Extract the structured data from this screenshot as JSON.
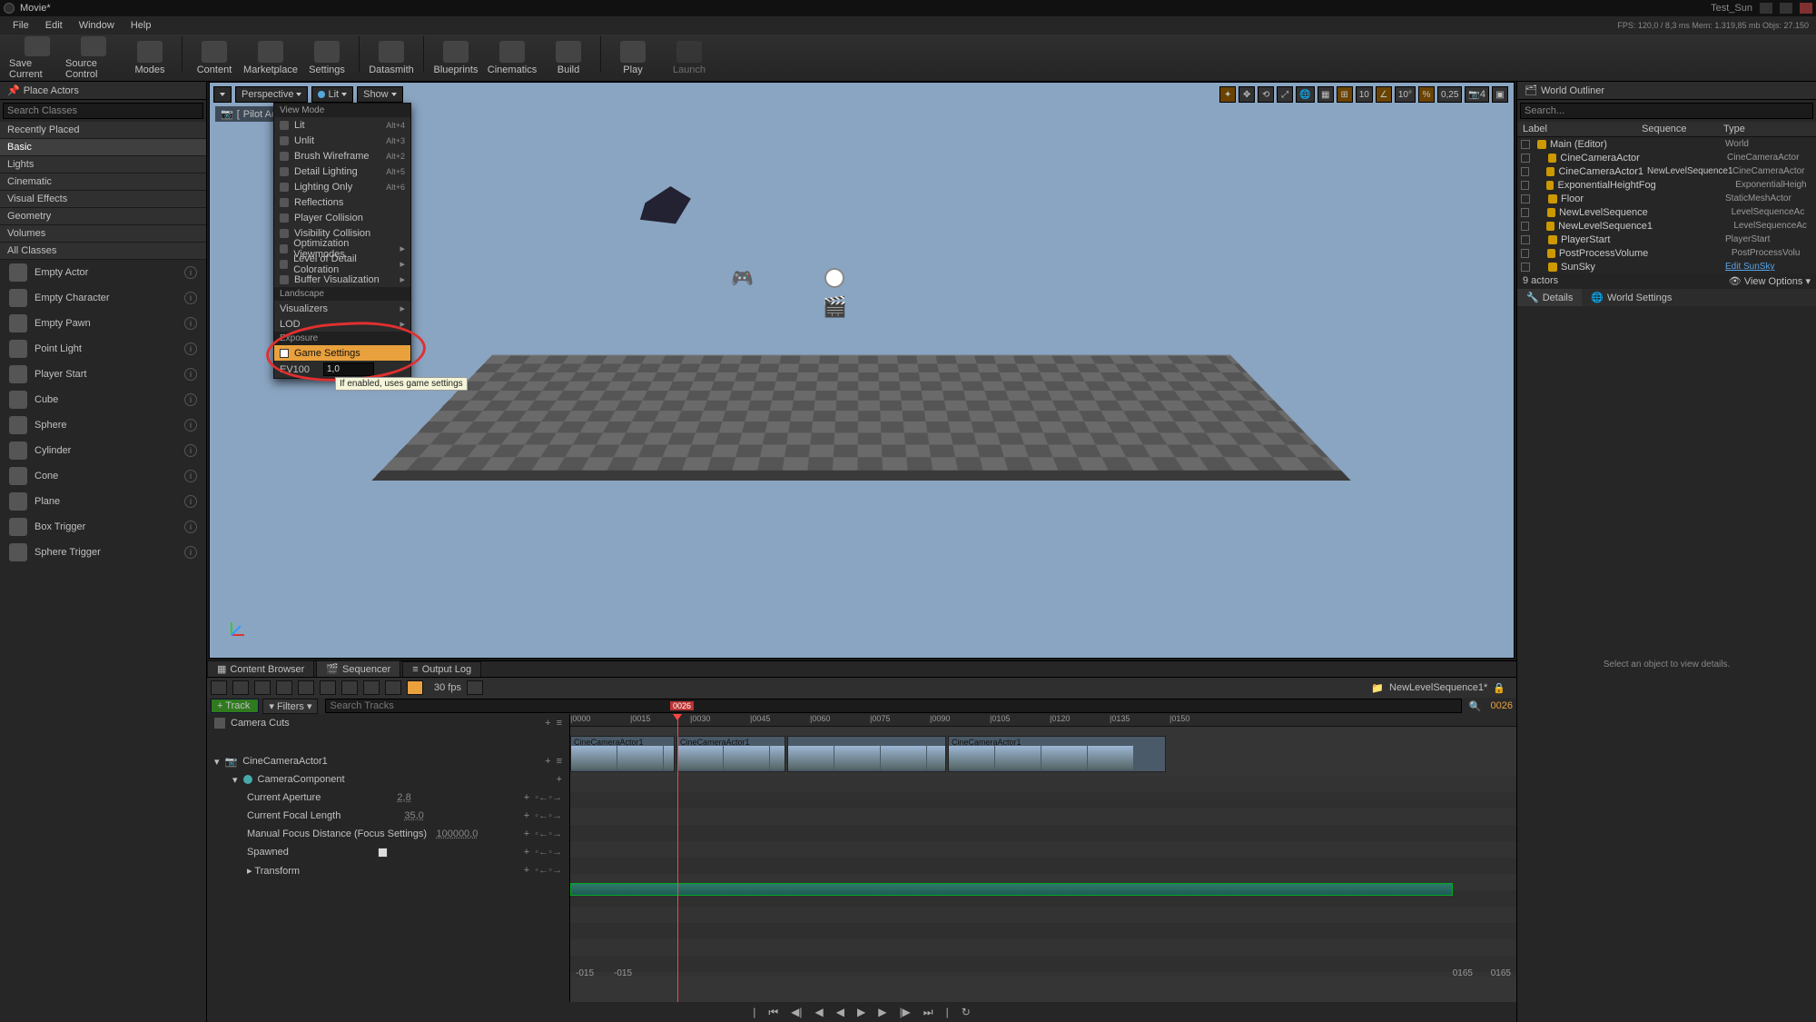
{
  "title_left": "Movie*",
  "title_right": "Test_Sun",
  "perf": "FPS: 120,0 / 8,3 ms   Mem: 1.319,85 mb   Objs: 27.150",
  "menu": [
    "File",
    "Edit",
    "Window",
    "Help"
  ],
  "toolbar": [
    {
      "label": "Save Current"
    },
    {
      "label": "Source Control"
    },
    {
      "label": "Modes"
    },
    {
      "label": "Content"
    },
    {
      "label": "Marketplace"
    },
    {
      "label": "Settings"
    },
    {
      "label": "Datasmith"
    },
    {
      "label": "Blueprints"
    },
    {
      "label": "Cinematics"
    },
    {
      "label": "Build"
    },
    {
      "label": "Play"
    },
    {
      "label": "Launch",
      "disabled": true
    }
  ],
  "placeactors": {
    "title": "Place Actors",
    "search_ph": "Search Classes",
    "cats": [
      "Recently Placed",
      "Basic",
      "Lights",
      "Cinematic",
      "Visual Effects",
      "Geometry",
      "Volumes",
      "All Classes"
    ],
    "sel": "Basic",
    "items": [
      "Empty Actor",
      "Empty Character",
      "Empty Pawn",
      "Point Light",
      "Player Start",
      "Cube",
      "Sphere",
      "Cylinder",
      "Cone",
      "Plane",
      "Box Trigger",
      "Sphere Trigger"
    ]
  },
  "viewport": {
    "btn_persp": "Perspective",
    "btn_lit": "Lit",
    "btn_show": "Show",
    "pilot": "Pilot Actv",
    "right_vals": {
      "grid": "10",
      "angle": "10°",
      "scale": "0,25",
      "cam": "4"
    },
    "menu_header": "View Mode",
    "modes": [
      {
        "n": "Lit",
        "sc": "Alt+4"
      },
      {
        "n": "Unlit",
        "sc": "Alt+3"
      },
      {
        "n": "Brush Wireframe",
        "sc": "Alt+2"
      },
      {
        "n": "Detail Lighting",
        "sc": "Alt+5"
      },
      {
        "n": "Lighting Only",
        "sc": "Alt+6"
      },
      {
        "n": "Reflections",
        "sc": ""
      },
      {
        "n": "Player Collision",
        "sc": ""
      },
      {
        "n": "Visibility Collision",
        "sc": ""
      },
      {
        "n": "Optimization Viewmodes",
        "ar": true
      },
      {
        "n": "Level of Detail Coloration",
        "ar": true
      },
      {
        "n": "Buffer Visualization",
        "ar": true
      }
    ],
    "landscape_hdr": "Landscape",
    "landscape": [
      {
        "n": "Visualizers",
        "ar": true
      },
      {
        "n": "LOD",
        "ar": true
      }
    ],
    "exposure_hdr": "Exposure",
    "game_settings": "Game Settings",
    "ev_label": "EV100",
    "ev_value": "1,0",
    "tooltip": "If enabled, uses game settings"
  },
  "bottom_tabs": [
    "Content Browser",
    "Sequencer",
    "Output Log"
  ],
  "seq": {
    "fps": "30 fps",
    "name": "NewLevelSequence1*",
    "track": "+ Track",
    "filters": "Filters",
    "search_ph": "Search Tracks",
    "frame_cur": "0026",
    "ruler": [
      "|0000",
      "|0015",
      "|0030",
      "|0045",
      "|0060",
      "|0075",
      "|0090",
      "|0105",
      "|0120",
      "|0135",
      "|0150"
    ],
    "clips": [
      "CineCameraActor1",
      "CineCameraActor1",
      "",
      "CineCameraActor1"
    ],
    "left_time": "-015",
    "right_time": "0165",
    "tracks": {
      "camcuts": "Camera Cuts",
      "actor": "CineCameraActor1",
      "comp": "CameraComponent",
      "p": [
        {
          "n": "Current Aperture",
          "v": "2,8"
        },
        {
          "n": "Current Focal Length",
          "v": "35,0"
        },
        {
          "n": "Manual Focus Distance (Focus Settings)",
          "v": "100000,0"
        },
        {
          "n": "Spawned",
          "cb": true
        },
        {
          "n": "Transform",
          "v": ""
        }
      ]
    }
  },
  "outliner": {
    "title": "World Outliner",
    "search_ph": "Search...",
    "cols": [
      "Label",
      "Sequence",
      "Type"
    ],
    "rows": [
      {
        "n": "Main (Editor)",
        "seq": "",
        "ty": "World",
        "ind": 0
      },
      {
        "n": "CineCameraActor",
        "seq": "",
        "ty": "CineCameraActor",
        "ind": 1
      },
      {
        "n": "CineCameraActor1",
        "seq": "NewLevelSequence1",
        "ty": "CineCameraActor",
        "ind": 1
      },
      {
        "n": "ExponentialHeightFog",
        "seq": "",
        "ty": "ExponentialHeigh",
        "ind": 1
      },
      {
        "n": "Floor",
        "seq": "",
        "ty": "StaticMeshActor",
        "ind": 1
      },
      {
        "n": "NewLevelSequence",
        "seq": "",
        "ty": "LevelSequenceAc",
        "ind": 1
      },
      {
        "n": "NewLevelSequence1",
        "seq": "",
        "ty": "LevelSequenceAc",
        "ind": 1
      },
      {
        "n": "PlayerStart",
        "seq": "",
        "ty": "PlayerStart",
        "ind": 1
      },
      {
        "n": "PostProcessVolume",
        "seq": "",
        "ty": "PostProcessVolu",
        "ind": 1
      },
      {
        "n": "SunSky",
        "seq": "",
        "ty": "Edit SunSky",
        "ind": 1,
        "link": true
      }
    ],
    "count": "9 actors",
    "viewopt": "View Options"
  },
  "details": {
    "t1": "Details",
    "t2": "World Settings",
    "msg": "Select an object to view details."
  }
}
